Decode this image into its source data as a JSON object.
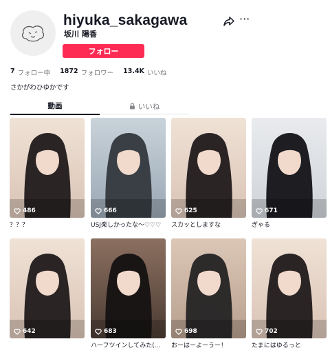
{
  "profile": {
    "username": "hiyuka_sakagawa",
    "nickname": "坂川 陽香",
    "follow_label": "フォロー",
    "bio": "さかがわひゆかです",
    "avatar_icon": "default-avatar-icon",
    "share_icon": "share-arrow-icon",
    "more_icon": "more-dots-icon",
    "more_glyph": "···"
  },
  "stats": [
    {
      "num": "7",
      "label": "フォロー中"
    },
    {
      "num": "1872",
      "label": "フォロワー"
    },
    {
      "num": "13.4K",
      "label": "いいね"
    }
  ],
  "tabs": {
    "videos": "動画",
    "liked": "いいね"
  },
  "colors": {
    "accent": "#fe2c55",
    "text": "#161823",
    "muted": "#6f7077"
  },
  "videos": [
    {
      "views": "486",
      "caption": "？？？",
      "theme": "warm-light"
    },
    {
      "views": "666",
      "caption": "USJ楽しかったな〜♡♡♡",
      "theme": "outdoor"
    },
    {
      "views": "625",
      "caption": "スカッとしますな",
      "theme": "warm-light"
    },
    {
      "views": "671",
      "caption": "ぎゃる",
      "theme": "cool-light"
    },
    {
      "views": "642",
      "caption": "",
      "theme": "warm-light"
    },
    {
      "views": "683",
      "caption": "ハーフツインしてみた(...",
      "theme": "dark"
    },
    {
      "views": "698",
      "caption": "おーはーよーうー！",
      "theme": "room"
    },
    {
      "views": "702",
      "caption": "たまにはゆるっと",
      "theme": "warm-light"
    }
  ]
}
